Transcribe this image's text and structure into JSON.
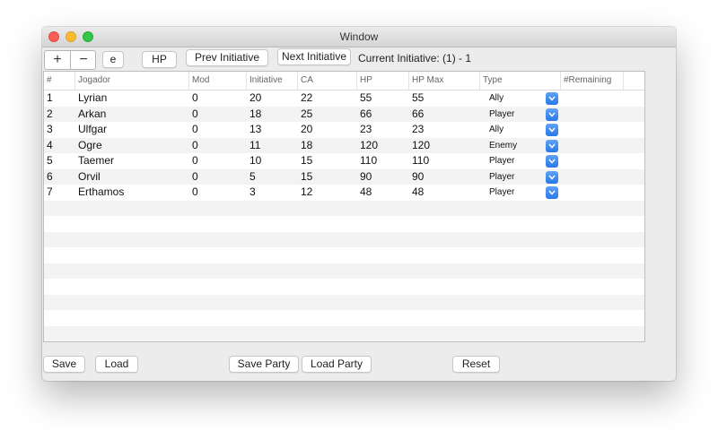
{
  "window": {
    "title": "Window"
  },
  "toolbar": {
    "plus_label": "+",
    "minus_label": "−",
    "e_label": "e",
    "hp_label": "HP",
    "prev_initiative_label": "Prev Initiative",
    "next_initiative_label": "Next Initiative",
    "current_initiative": "Current Initiative: (1) - 1"
  },
  "table": {
    "columns": [
      "#",
      "Jogador",
      "Mod",
      "Initiative",
      "CA",
      "HP",
      "HP Max",
      "Type",
      "#Remaining"
    ],
    "rows": [
      {
        "num": "1",
        "player": "Lyrian",
        "mod": "0",
        "initiative": "20",
        "ca": "22",
        "hp": "55",
        "hp_max": "55",
        "type": "Ally"
      },
      {
        "num": "2",
        "player": "Arkan",
        "mod": "0",
        "initiative": "18",
        "ca": "25",
        "hp": "66",
        "hp_max": "66",
        "type": "Player"
      },
      {
        "num": "3",
        "player": "Ulfgar",
        "mod": "0",
        "initiative": "13",
        "ca": "20",
        "hp": "23",
        "hp_max": "23",
        "type": "Ally"
      },
      {
        "num": "4",
        "player": "Ogre",
        "mod": "0",
        "initiative": "11",
        "ca": "18",
        "hp": "120",
        "hp_max": "120",
        "type": "Enemy"
      },
      {
        "num": "5",
        "player": "Taemer",
        "mod": "0",
        "initiative": "10",
        "ca": "15",
        "hp": "110",
        "hp_max": "110",
        "type": "Player"
      },
      {
        "num": "6",
        "player": "Orvil",
        "mod": "0",
        "initiative": "5",
        "ca": "15",
        "hp": "90",
        "hp_max": "90",
        "type": "Player"
      },
      {
        "num": "7",
        "player": "Erthamos",
        "mod": "0",
        "initiative": "3",
        "ca": "12",
        "hp": "48",
        "hp_max": "48",
        "type": "Player"
      }
    ]
  },
  "footer": {
    "save_label": "Save",
    "load_label": "Load",
    "save_party_label": "Save Party",
    "load_party_label": "Load Party",
    "reset_label": "Reset"
  },
  "icons": {
    "dropdown": "chevron-down-icon"
  },
  "colors": {
    "close": "#fc5f57",
    "minimize": "#fdbc2e",
    "maximize": "#33c748",
    "accent": "#2a78e8",
    "stripe": "#f3f3f3"
  }
}
